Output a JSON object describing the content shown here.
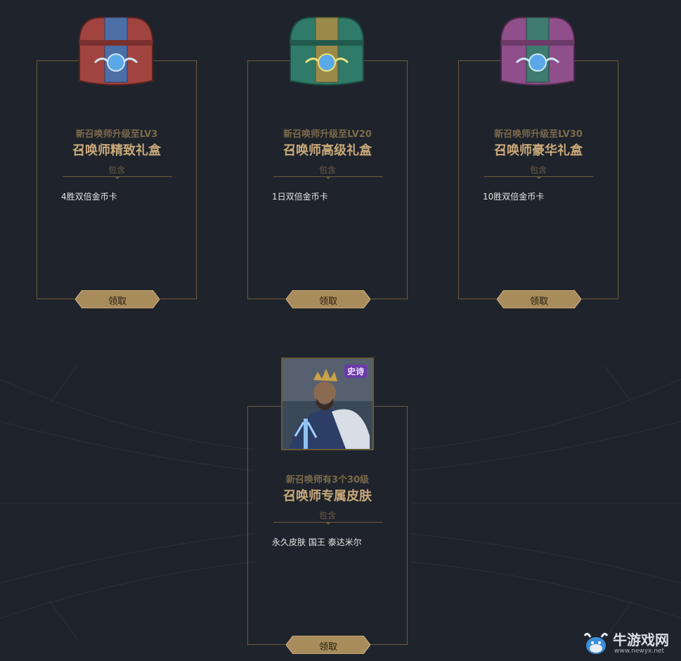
{
  "cards": [
    {
      "requirement": "新召唤师升级至LV3",
      "title": "召唤师精致礼盒",
      "contains_label": "包含",
      "item": "4胜双倍金币卡",
      "button_label": "领取",
      "chest_color": "#a14440"
    },
    {
      "requirement": "新召唤师升级至LV20",
      "title": "召唤师高级礼盒",
      "contains_label": "包含",
      "item": "1日双倍金币卡",
      "button_label": "领取",
      "chest_color": "#2f7a68"
    },
    {
      "requirement": "新召唤师升级至LV30",
      "title": "召唤师豪华礼盒",
      "contains_label": "包含",
      "item": "10胜双倍金币卡",
      "button_label": "领取",
      "chest_color": "#8e4f8a"
    },
    {
      "requirement": "新召唤师有3个30级",
      "title": "召唤师专属皮肤",
      "contains_label": "包含",
      "item": "永久皮肤 国王 泰达米尔",
      "button_label": "领取",
      "badge": "史诗"
    }
  ],
  "watermark": {
    "text": "牛游戏网",
    "url": "www.newyx.net",
    "icon": "cow-mascot-icon"
  },
  "colors": {
    "background": "#1f232b",
    "gold": "#c8a97a",
    "border": "#6e5c3e",
    "button": "#a88c5c"
  }
}
